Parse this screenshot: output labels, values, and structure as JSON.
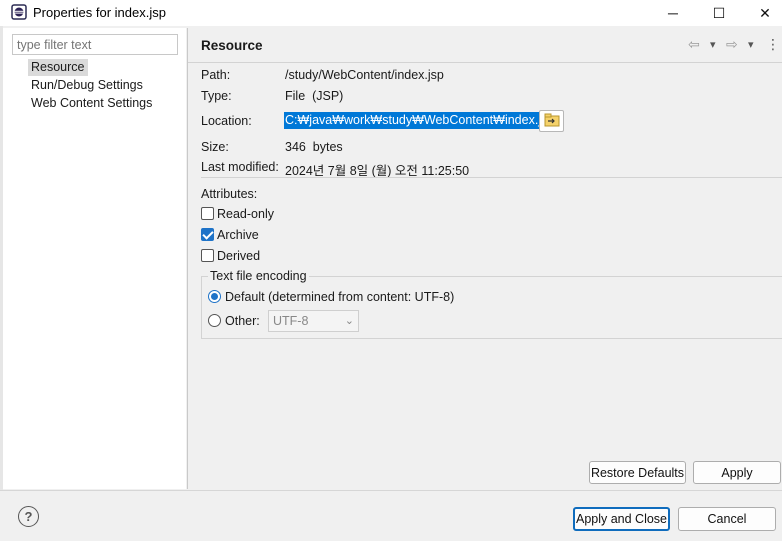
{
  "window": {
    "title": "Properties for index.jsp",
    "minimize_glyph": "─",
    "maximize_glyph": "☐",
    "close_glyph": "✕"
  },
  "sidebar": {
    "filter_placeholder": "type filter text",
    "items": [
      {
        "label": "Resource",
        "selected": true
      },
      {
        "label": "Run/Debug Settings",
        "selected": false
      },
      {
        "label": "Web Content Settings",
        "selected": false
      }
    ]
  },
  "page": {
    "title": "Resource",
    "nav": {
      "back_glyph": "⇦",
      "dropdown_glyph": "▾",
      "forward_glyph": "⇨",
      "menu_glyph": "⋮"
    },
    "fields": {
      "path_label": "Path:",
      "path_value": "/study/WebContent/index.jsp",
      "type_label": "Type:",
      "type_value": "File  (JSP)",
      "location_label": "Location:",
      "location_value": "C:₩java₩work₩study₩WebContent₩index.jsp",
      "size_label": "Size:",
      "size_value": "346  bytes",
      "modified_label": "Last modified:",
      "modified_value": "2024년 7월 8일 (월) 오전 11:25:50"
    },
    "attributes": {
      "label": "Attributes:",
      "read_only": {
        "label": "Read-only",
        "checked": false
      },
      "archive": {
        "label": "Archive",
        "checked": true
      },
      "derived": {
        "label": "Derived",
        "checked": false
      }
    },
    "encoding": {
      "legend": "Text file encoding",
      "default_label": "Default (determined from content: UTF-8)",
      "other_label": "Other:",
      "other_value": "UTF-8",
      "selected": "default"
    },
    "restore_defaults_label": "Restore Defaults",
    "apply_label": "Apply"
  },
  "footer": {
    "help_glyph": "?",
    "apply_close_label": "Apply and Close",
    "cancel_label": "Cancel"
  },
  "colors": {
    "selection": "#0078d7",
    "accent": "#1e73c8"
  }
}
